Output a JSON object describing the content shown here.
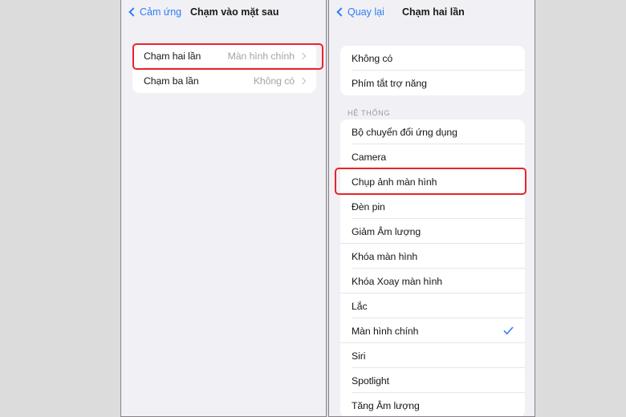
{
  "left_panel": {
    "nav": {
      "back_label": "Cảm ứng",
      "title": "Chạm vào mặt sau",
      "back_icon": "chevron-left-icon"
    },
    "rows": [
      {
        "label": "Chạm hai lần",
        "value": "Màn hình chính",
        "chevron": "chevron-right-icon",
        "highlighted": true
      },
      {
        "label": "Chạm ba lần",
        "value": "Không có",
        "chevron": "chevron-right-icon",
        "highlighted": false
      }
    ]
  },
  "right_panel": {
    "nav": {
      "back_label": "Quay lại",
      "title": "Chạm hai lần",
      "back_icon": "chevron-left-icon"
    },
    "top_group": [
      {
        "label": "Không có",
        "selected": false
      },
      {
        "label": "Phím tắt trợ năng",
        "selected": false
      }
    ],
    "section_title": "HỆ THỐNG",
    "system_group": [
      {
        "label": "Bộ chuyển đổi ứng dụng",
        "selected": false,
        "highlighted": false
      },
      {
        "label": "Camera",
        "selected": false,
        "highlighted": false
      },
      {
        "label": "Chụp ảnh màn hình",
        "selected": false,
        "highlighted": true
      },
      {
        "label": "Đèn pin",
        "selected": false,
        "highlighted": false
      },
      {
        "label": "Giảm Âm lượng",
        "selected": false,
        "highlighted": false
      },
      {
        "label": "Khóa màn hình",
        "selected": false,
        "highlighted": false
      },
      {
        "label": "Khóa Xoay màn hình",
        "selected": false,
        "highlighted": false
      },
      {
        "label": "Lắc",
        "selected": false,
        "highlighted": false
      },
      {
        "label": "Màn hình chính",
        "selected": true,
        "highlighted": false
      },
      {
        "label": "Siri",
        "selected": false,
        "highlighted": false
      },
      {
        "label": "Spotlight",
        "selected": false,
        "highlighted": false
      },
      {
        "label": "Tăng Âm lượng",
        "selected": false,
        "highlighted": false
      }
    ],
    "checkmark_icon": "checkmark-icon"
  },
  "colors": {
    "accent_blue": "#2f7cf6",
    "highlight_red": "#e8242a",
    "panel_background": "#f1f0f4",
    "card_background": "#ffffff",
    "page_background": "#dcdcdc",
    "secondary_text": "#a3a3a8"
  }
}
